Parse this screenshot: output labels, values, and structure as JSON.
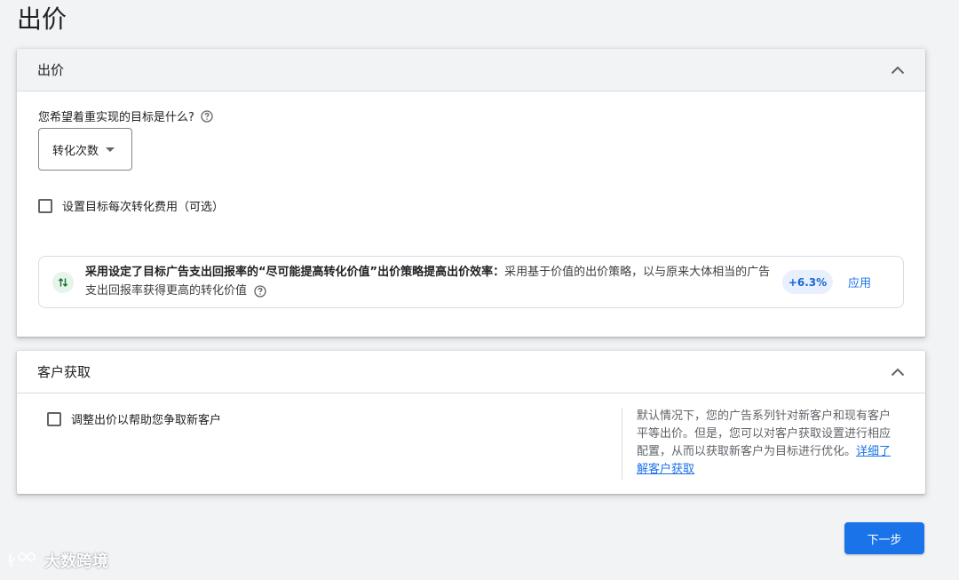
{
  "page": {
    "title": "出价"
  },
  "bidding_card": {
    "header": "出价",
    "question": "您希望着重实现的目标是什么?",
    "dropdown_value": "转化次数",
    "target_cpa_checkbox_label": "设置目标每次转化费用（可选）",
    "recommendation": {
      "bold_text": "采用设定了目标广告支出回报率的“尽可能提高转化价值”出价策略提高出价效率：",
      "text": "采用基于价值的出价策略，以与原来大体相当的广告支出回报率获得更高的转化价值",
      "badge": "+6.3%",
      "apply_label": "应用"
    }
  },
  "acquisition_card": {
    "header": "客户获取",
    "checkbox_label": "调整出价以帮助您争取新客户",
    "description": "默认情况下，您的广告系列针对新客户和现有客户平等出价。但是，您可以对客户获取设置进行相应配置，从而以获取新客户为目标进行优化。",
    "learn_more_link": "详细了解客户获取"
  },
  "footer": {
    "next_button": "下一步"
  },
  "watermark": {
    "text": "大数跨境"
  },
  "colors": {
    "primary": "#1a73e8",
    "background": "#f1f3f4",
    "badge_bg": "#e8f0fe",
    "icon_bg": "#e6f4ea",
    "icon_fg": "#137333"
  },
  "icons": {
    "collapse": "chevron-up-icon",
    "help": "help-circle-icon",
    "recommendation": "swap-vertical-icon",
    "dropdown": "caret-down-icon"
  }
}
